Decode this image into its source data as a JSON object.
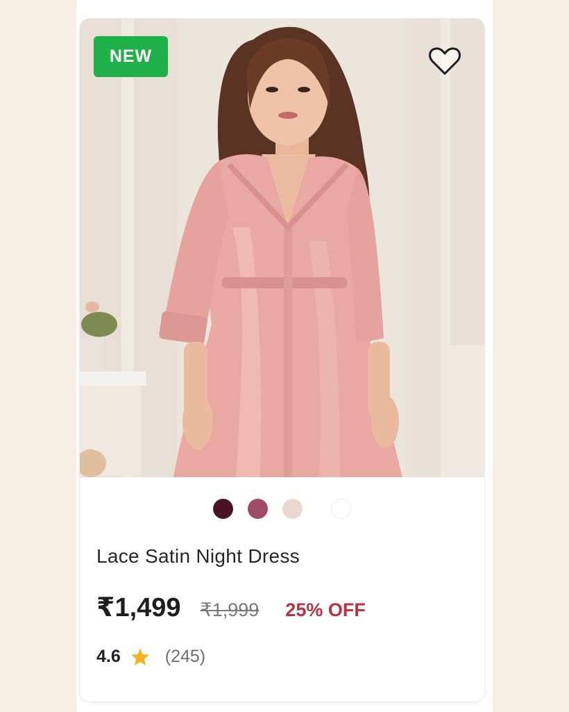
{
  "product": {
    "badge": "NEW",
    "name": "Lace Satin Night Dress",
    "price": "₹1,499",
    "mrp": "₹1,999",
    "discount": "25% OFF",
    "rating": "4.6",
    "review_count": "(245)",
    "image_icon": "product-photo-woman-in-pink-satin-night-dress",
    "wishlist_icon": "heart-outline-icon",
    "rating_icon": "star-icon",
    "swatch_colors": [
      "#4a1426",
      "#a04a68",
      "#e8d8d0",
      "#efefef"
    ],
    "colors": {
      "badge": "#20b04a",
      "discount": "#b8333f",
      "star": "#f5b21b"
    }
  }
}
